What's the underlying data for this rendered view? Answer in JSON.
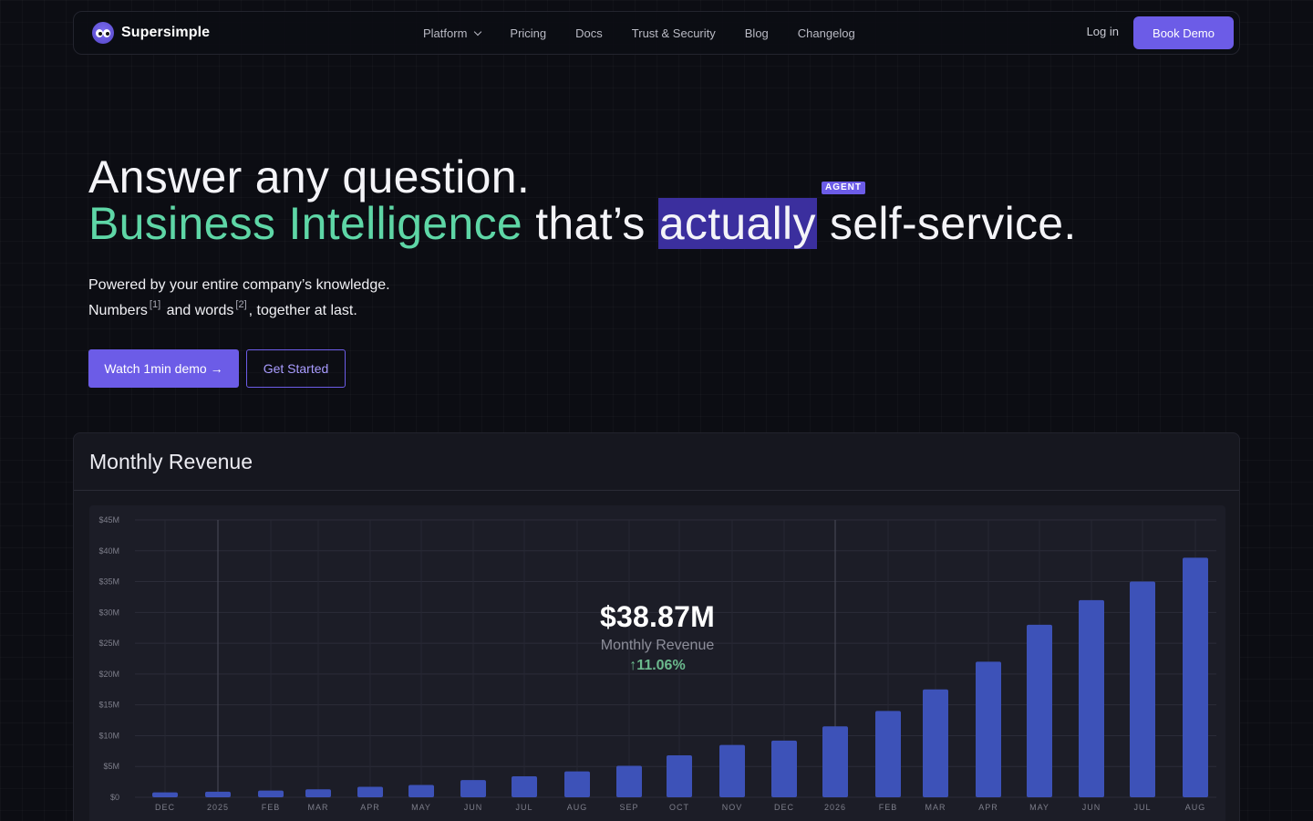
{
  "nav": {
    "brand": "Supersimple",
    "items": [
      "Platform",
      "Pricing",
      "Docs",
      "Trust & Security",
      "Blog",
      "Changelog"
    ],
    "login": "Log in",
    "cta": "Book Demo"
  },
  "hero": {
    "line1": "Answer any question.",
    "line2_green": "Business Intelligence",
    "line2_mid": " that’s ",
    "line2_highlight": "actually",
    "line2_end": " self-service.",
    "badge": "AGENT",
    "sub1": "Powered by your entire company’s knowledge.",
    "sub2_a": "Numbers",
    "sub2_ref1": "[1]",
    "sub2_b": " and words",
    "sub2_ref2": "[2]",
    "sub2_c": ", together at last.",
    "btn_watch": "Watch 1min demo →",
    "btn_start": "Get Started"
  },
  "card": {
    "title": "Monthly Revenue",
    "kpi_value": "$38.87M",
    "kpi_label": "Monthly Revenue",
    "kpi_delta": "↑11.06%"
  },
  "colors": {
    "accent": "#6c5ce7",
    "green": "#5ed6a6",
    "bar": "#3d52b8",
    "highlight": "#3b2f9e"
  },
  "chart_data": {
    "type": "bar",
    "title": "Monthly Revenue",
    "ylim": [
      0,
      45
    ],
    "y_unit": "M",
    "yticks": [
      "$0",
      "$5M",
      "$10M",
      "$15M",
      "$20M",
      "$25M",
      "$30M",
      "$35M",
      "$40M",
      "$45M"
    ],
    "categories": [
      "DEC",
      "2025",
      "FEB",
      "MAR",
      "APR",
      "MAY",
      "JUN",
      "JUL",
      "AUG",
      "SEP",
      "OCT",
      "NOV",
      "DEC",
      "2026",
      "FEB",
      "MAR",
      "APR",
      "MAY",
      "JUN",
      "JUL",
      "AUG"
    ],
    "values": [
      0.8,
      0.9,
      1.1,
      1.3,
      1.7,
      2.0,
      2.8,
      3.4,
      4.2,
      5.1,
      6.8,
      8.5,
      9.2,
      11.5,
      14.0,
      17.5,
      22.0,
      28.0,
      32.0,
      35.0,
      38.87
    ],
    "year_markers": [
      "2025",
      "2026"
    ],
    "grid": true
  }
}
